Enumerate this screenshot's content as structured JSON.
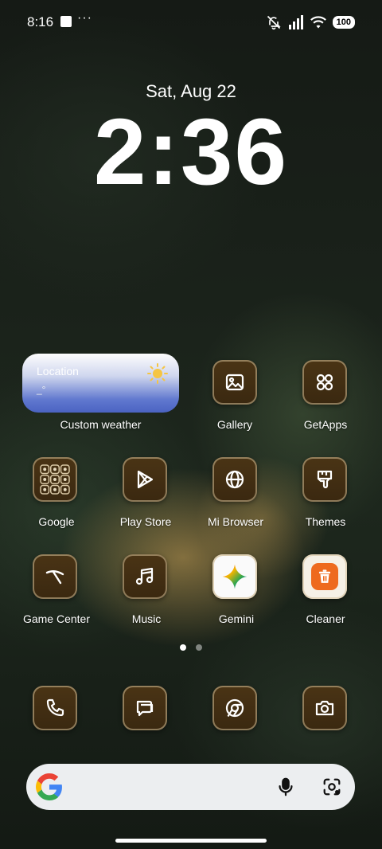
{
  "status_bar": {
    "time": "8:16",
    "dots": "···",
    "battery": "100"
  },
  "lock": {
    "date": "Sat, Aug 22",
    "time": "2:36"
  },
  "weather": {
    "location": "Location",
    "temp": "_°",
    "label": "Custom weather"
  },
  "apps": {
    "gallery": "Gallery",
    "getapps": "GetApps",
    "google": "Google",
    "playstore": "Play Store",
    "mibrowser": "Mi Browser",
    "themes": "Themes",
    "gamecenter": "Game Center",
    "music": "Music",
    "gemini": "Gemini",
    "cleaner": "Cleaner"
  },
  "dock": [
    "phone-icon",
    "messages-icon",
    "chrome-icon",
    "camera-icon"
  ],
  "colors": {
    "icon_bg": "#3f2c12",
    "icon_border": "#c9b48c",
    "cleaner_orange": "#ee6a1e",
    "weather_blue": "#5670cb"
  }
}
